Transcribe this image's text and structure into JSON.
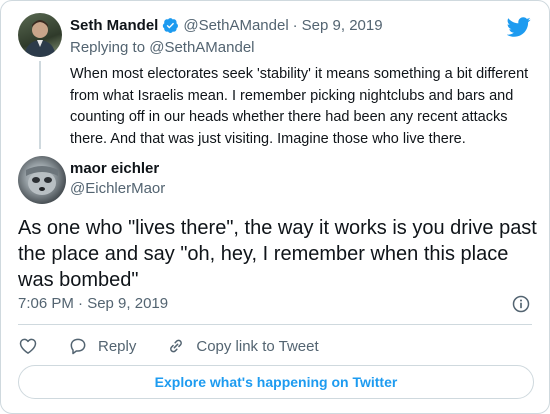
{
  "parent_tweet": {
    "name": "Seth Mandel",
    "handle": "@SethAMandel",
    "date": "Sep 9, 2019",
    "replying_prefix": "Replying to",
    "replying_to": "@SethAMandel",
    "text": "When most electorates seek 'stability' it means something a bit different from what Israelis mean. I remember picking nightclubs and bars and counting off in our heads whether there had been any recent attacks there. And that was just visiting. Imagine those who live there."
  },
  "main_tweet": {
    "name": "maor eichler",
    "handle": "@EichlerMaor",
    "text": "As one who \"lives there\", the way it works is you drive past the place and say \"oh, hey, I remember when this place was bombed\"",
    "timestamp": "7:06 PM · Sep 9, 2019"
  },
  "actions": {
    "reply": "Reply",
    "copy_link": "Copy link to Tweet"
  },
  "explore_button": "Explore what's happening on Twitter",
  "icons": {
    "brand": "twitter-bird-icon",
    "verified": "verified-badge-icon",
    "info": "info-icon",
    "like": "heart-icon",
    "reply": "reply-bubble-icon",
    "copy_link": "link-icon"
  },
  "colors": {
    "accent": "#1d9bf0",
    "secondary_text": "#536471",
    "border": "#cfd9de"
  }
}
